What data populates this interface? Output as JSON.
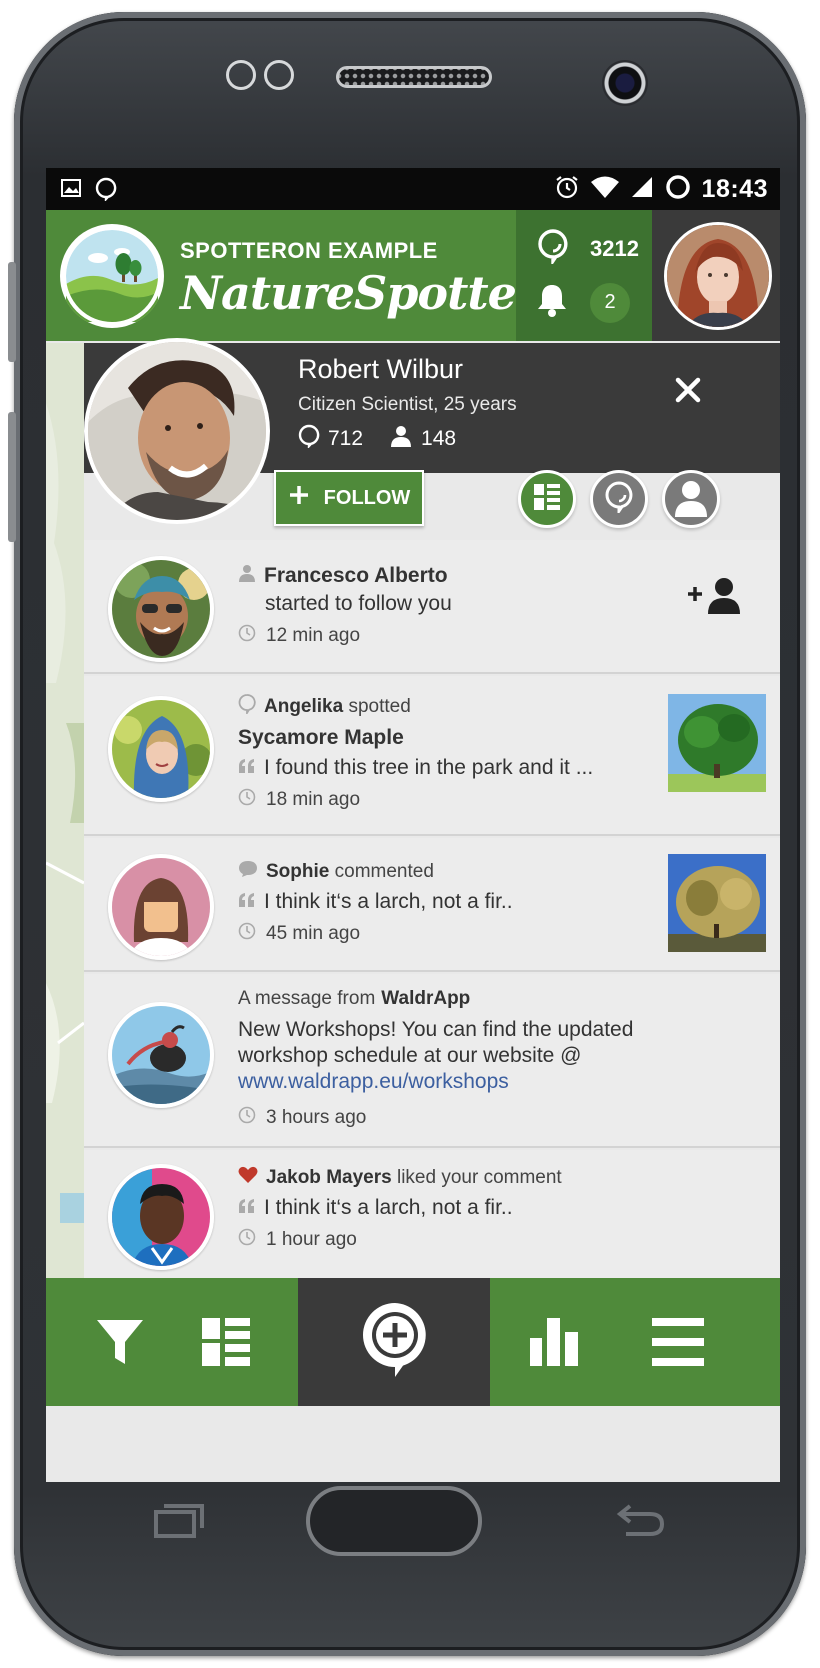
{
  "status_bar": {
    "time": "18:43"
  },
  "header": {
    "brand_top": "SPOTTERON EXAMPLE",
    "brand_main": "NatureSpotter",
    "spots_count": "3212",
    "notifications_count": "2"
  },
  "profile": {
    "name": "Robert Wilbur",
    "subtitle": "Citizen Scientist, 25 years",
    "spots": "712",
    "followers": "148",
    "follow_label": "FOLLOW"
  },
  "feed": [
    {
      "name": "Francesco Alberto",
      "body": "started to follow you",
      "time": "12 min ago"
    },
    {
      "name": "Angelika",
      "action": "spotted",
      "title": "Sycamore Maple",
      "quote": "I found this tree in the park and it ...",
      "time": "18 min ago"
    },
    {
      "name": "Sophie",
      "action": "commented",
      "quote": "I think it‘s a larch, not a fir..",
      "time": "45 min ago"
    },
    {
      "prefix": "A message from",
      "name": "WaldrApp",
      "body1": "New Workshops! You can find the updated",
      "body2": "workshop schedule at our website @",
      "link": "www.waldrapp.eu/workshops",
      "time": "3 hours ago"
    },
    {
      "name": "Jakob Mayers",
      "action": "liked your comment",
      "quote": "I think it‘s a larch, not a fir..",
      "time": "1 hour ago"
    }
  ],
  "colors": {
    "brand_green": "#4f8a3a",
    "dark_green": "#3d7230",
    "dark_gray": "#3a3a3a",
    "link": "#3c5fa0"
  }
}
